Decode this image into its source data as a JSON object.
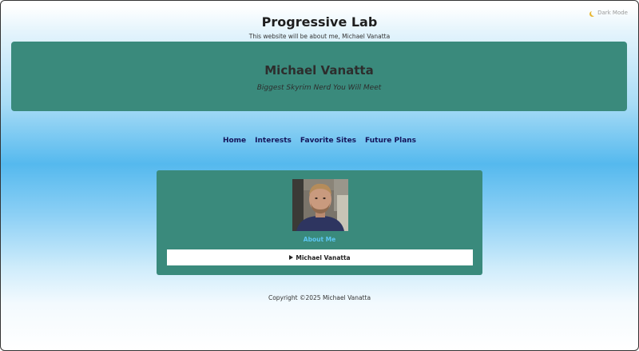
{
  "header": {
    "dark_mode_label": "Dark Mode",
    "site_title": "Progressive Lab",
    "site_subtitle": "This website will be about me, Michael Vanatta"
  },
  "hero": {
    "name": "Michael Vanatta",
    "tagline": "Biggest Skyrim Nerd You Will Meet"
  },
  "nav": {
    "items": [
      {
        "label": "Home"
      },
      {
        "label": "Interests"
      },
      {
        "label": "Favorite Sites"
      },
      {
        "label": "Future Plans"
      }
    ]
  },
  "profile_card": {
    "about_link": "About Me",
    "details_summary": "Michael Vanatta"
  },
  "footer": {
    "copyright": "Copyright ©2025 Michael Vanatta"
  },
  "colors": {
    "panel": "#3a8a7c",
    "nav_link": "#14145a",
    "about_link": "#5cc6f2",
    "background_accent": "#55b9ee"
  }
}
